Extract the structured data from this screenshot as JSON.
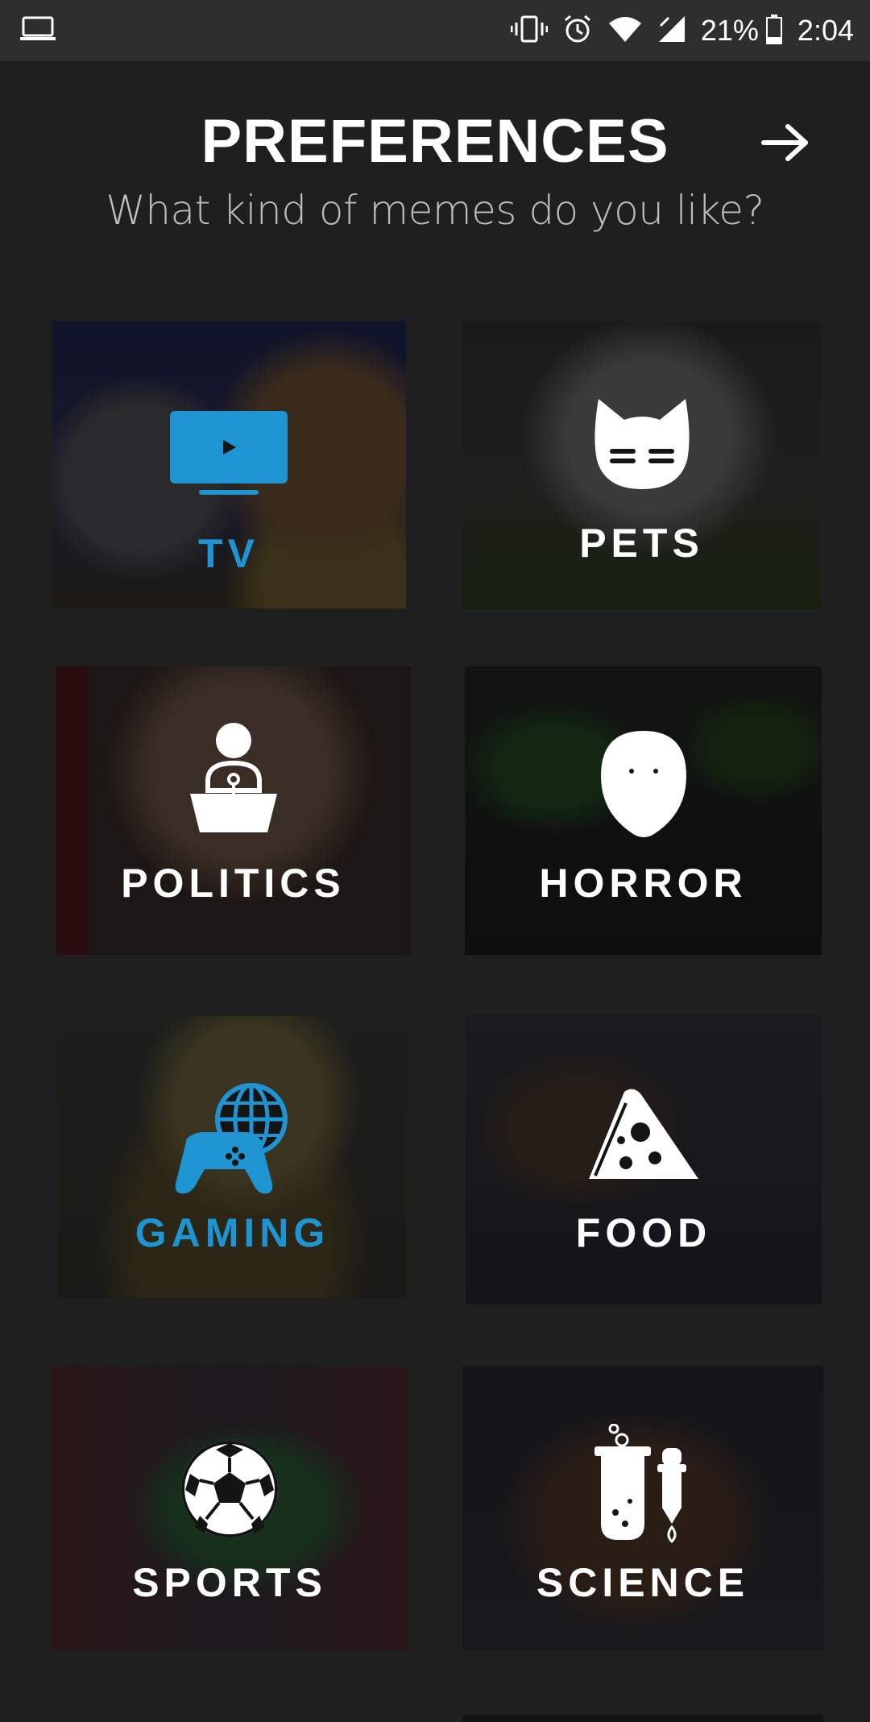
{
  "status_bar": {
    "battery": "21%",
    "time": "2:04"
  },
  "header": {
    "title": "PREFERENCES",
    "subtitle": "What kind of memes do you like?"
  },
  "colors": {
    "background": "#1f1f1f",
    "accent": "#1e94d2",
    "status_bar": "#2e2e2e"
  },
  "categories": [
    {
      "label": "TV",
      "icon": "tv-icon",
      "selected": true
    },
    {
      "label": "PETS",
      "icon": "cat-icon",
      "selected": false
    },
    {
      "label": "POLITICS",
      "icon": "podium-icon",
      "selected": false
    },
    {
      "label": "HORROR",
      "icon": "mask-icon",
      "selected": false
    },
    {
      "label": "GAMING",
      "icon": "gamepad-icon",
      "selected": true
    },
    {
      "label": "FOOD",
      "icon": "pizza-icon",
      "selected": false
    },
    {
      "label": "SPORTS",
      "icon": "soccer-ball-icon",
      "selected": false
    },
    {
      "label": "SCIENCE",
      "icon": "test-tube-icon",
      "selected": false
    }
  ]
}
